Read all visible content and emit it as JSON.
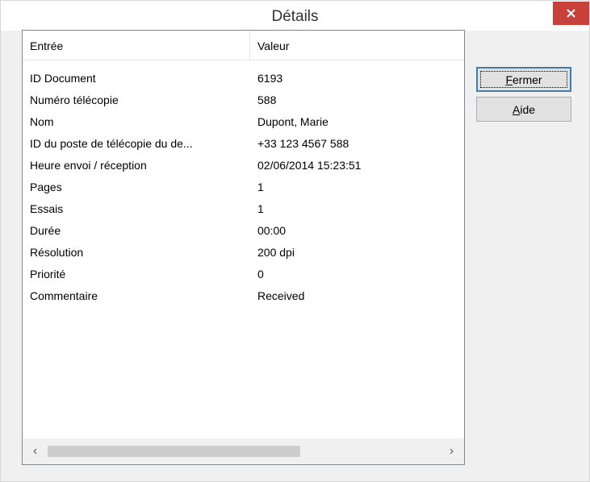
{
  "window": {
    "title": "Détails",
    "close_glyph": "×"
  },
  "list": {
    "columns": [
      "Entrée",
      "Valeur"
    ],
    "rows": [
      {
        "entry": "ID Document",
        "value": "6193"
      },
      {
        "entry": "Numéro télécopie",
        "value": "588"
      },
      {
        "entry": "Nom",
        "value": "Dupont, Marie"
      },
      {
        "entry": "ID du poste de télécopie du de...",
        "value": "+33 123 4567 588"
      },
      {
        "entry": "Heure envoi / réception",
        "value": "02/06/2014 15:23:51"
      },
      {
        "entry": "Pages",
        "value": "1"
      },
      {
        "entry": "Essais",
        "value": "1"
      },
      {
        "entry": "Durée",
        "value": "00:00"
      },
      {
        "entry": "Résolution",
        "value": "200 dpi"
      },
      {
        "entry": "Priorité",
        "value": "0"
      },
      {
        "entry": "Commentaire",
        "value": "Received"
      }
    ],
    "scroll_left_glyph": "‹",
    "scroll_right_glyph": "›"
  },
  "buttons": {
    "fermer": {
      "mnemonic": "F",
      "rest": "ermer"
    },
    "aide": {
      "mnemonic": "A",
      "rest": "ide"
    }
  },
  "colors": {
    "close_button": "#c7403a",
    "default_button_border": "#3c7fb1"
  }
}
